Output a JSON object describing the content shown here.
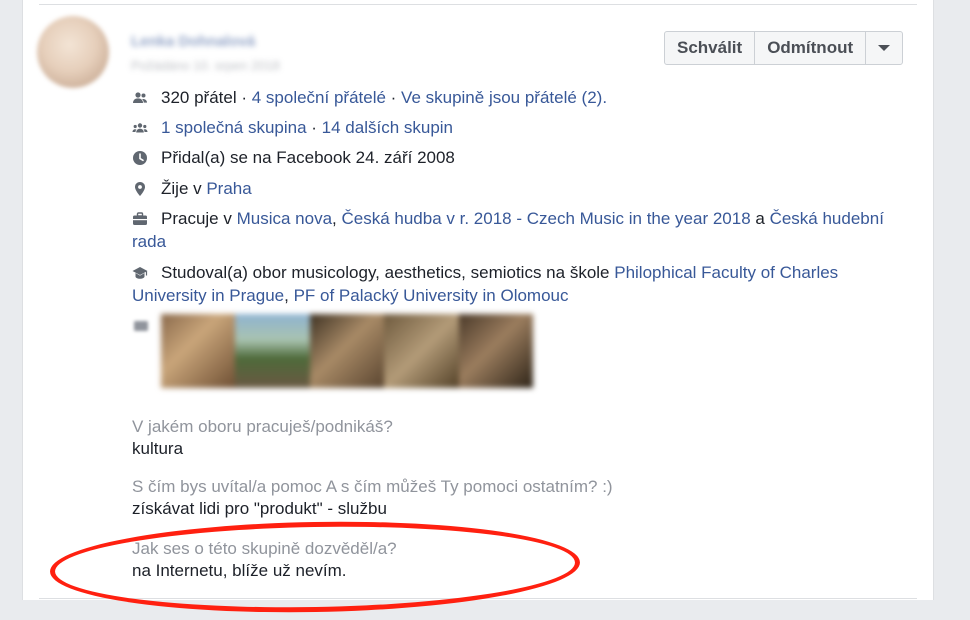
{
  "header": {
    "approve_label": "Schválit",
    "decline_label": "Odmítnout"
  },
  "profile": {
    "name": "Lenka Dohnalová",
    "joined": "Požádáno 10. srpen 2018"
  },
  "stats": {
    "friends": "320 přátel",
    "sep": " · ",
    "mutual_friends": "4 společní přátelé",
    "friends_in_group": "Ve skupině jsou přátelé (2).",
    "mutual_group": "1 společná skupina",
    "other_groups": "14 dalších skupin"
  },
  "facebook_joined": "Přidal(a) se na Facebook 24. září 2008",
  "lives": {
    "prefix": "Žije v ",
    "place": "Praha"
  },
  "works": {
    "prefix": "Pracuje v ",
    "employer1": "Musica nova",
    "comma": ", ",
    "employer2": "Česká hudba v r. 2018 - Czech Music in the year 2018",
    "and": " a ",
    "employer3": "Česká hudební rada"
  },
  "studied": {
    "prefix": "Studoval(a) obor musicology, aesthetics, semiotics na škole ",
    "school1": "Philophical Faculty of Charles University in Prague",
    "comma": ", ",
    "school2": "PF of Palacký University in Olomouc"
  },
  "questions": [
    {
      "q": "V jakém oboru pracuješ/podnikáš?",
      "a": "kultura"
    },
    {
      "q": "S čím bys uvítal/a pomoc A s čím můžeš Ty pomoci ostatním? :)",
      "a": "získávat lidi pro \"produkt\" - službu"
    },
    {
      "q": "Jak ses o této skupině dozvěděl/a?",
      "a": "na Internetu, blíže už nevím."
    }
  ],
  "colors": {
    "link": "#385898",
    "annotation": "#ff2010"
  }
}
